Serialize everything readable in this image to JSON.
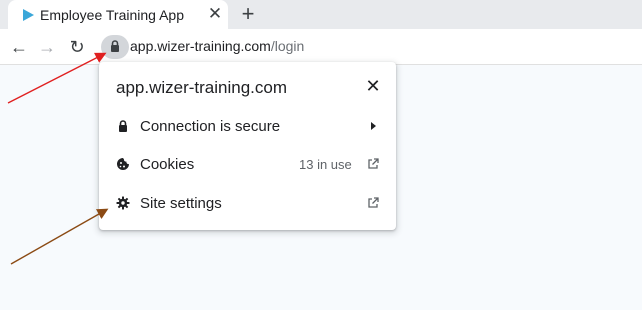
{
  "tab": {
    "title": "Employee Training App",
    "favicon": "play-triangle-icon",
    "close": "✕",
    "new_tab": "+"
  },
  "toolbar": {
    "back": "←",
    "forward": "→",
    "reload": "↻",
    "lock_icon": "lock-icon",
    "url_host": "app.wizer-training.com",
    "url_path": "/login"
  },
  "popup": {
    "host": "app.wizer-training.com",
    "close": "✕",
    "rows": [
      {
        "label": "Connection is secure",
        "icon": "lock-icon"
      },
      {
        "label": "Cookies",
        "icon": "cookie-icon",
        "count": "13 in use"
      },
      {
        "label": "Site settings",
        "icon": "gear-icon"
      }
    ]
  },
  "colors": {
    "page_bg": "#f7fafd",
    "tabstrip_bg": "#e8eaed",
    "favicon": "#3ba7d9",
    "arrow_red": "#e02020",
    "arrow_brown": "#8b4a14"
  }
}
